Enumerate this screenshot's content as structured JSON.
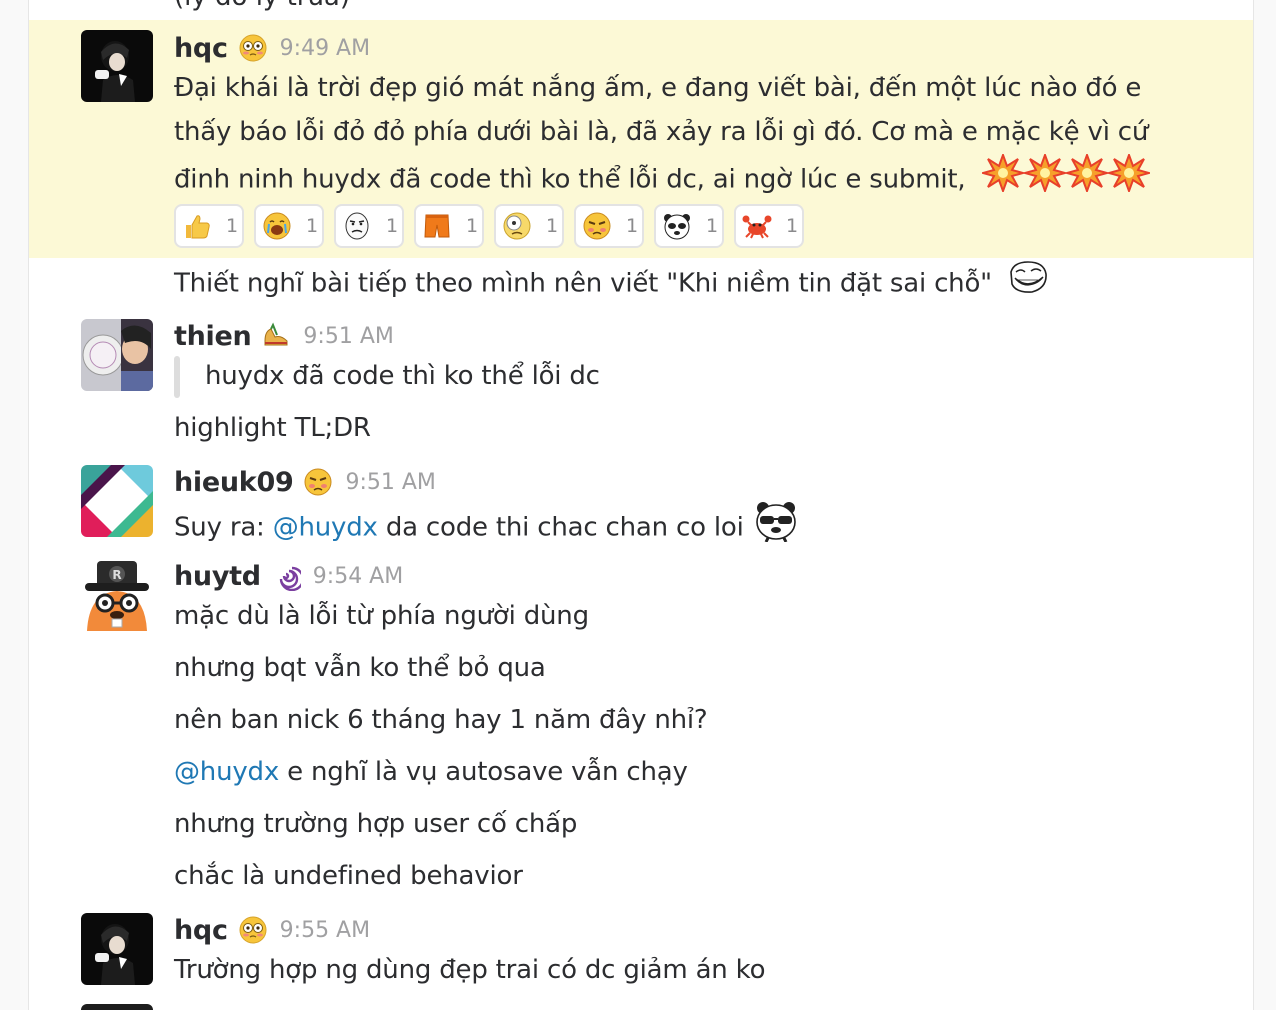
{
  "top_cut_text": "(lý do lý trưa)",
  "messages": [
    {
      "author": "hqc",
      "time": "9:49 AM",
      "lines": [
        "Đại khái là trời đẹp gió mát nắng ấm, e đang viết bài, đến một lúc nào đó e",
        "thấy báo lỗi đỏ đỏ phía dưới bài là, đã xảy ra lỗi gì đó. Cơ mà e mặc kệ vì cứ",
        "đinh ninh huydx đã code thì ko thể lỗi dc, ai ngờ lúc e submit,"
      ],
      "reactions": [
        {
          "icon": "thumbs-up-icon",
          "count": "1"
        },
        {
          "icon": "crying-face-icon",
          "count": "1"
        },
        {
          "icon": "meme-face-icon",
          "count": "1"
        },
        {
          "icon": "shorts-icon",
          "count": "1"
        },
        {
          "icon": "dizzy-face-icon",
          "count": "1"
        },
        {
          "icon": "angry-face-icon",
          "count": "1"
        },
        {
          "icon": "panda-icon",
          "count": "1"
        },
        {
          "icon": "crab-icon",
          "count": "1"
        }
      ],
      "followup": "Thiết nghĩ bài tiếp theo mình nên viết \"Khi niềm tin đặt sai chỗ\""
    },
    {
      "author": "thien",
      "time": "9:51 AM",
      "quote": "huydx đã code thì ko thể lỗi dc",
      "lines": [
        "highlight TL;DR"
      ]
    },
    {
      "author": "hieuk09",
      "time": "9:51 AM",
      "prefix": "Suy ra:",
      "mention": "@huydx",
      "suffix": "da code thi chac chan co loi"
    },
    {
      "author": "huytd",
      "time": "9:54 AM",
      "lines": [
        "mặc dù là lỗi từ phía người dùng",
        "nhưng bqt vẫn ko thể bỏ qua",
        "nên ban nick 6 tháng hay 1 năm đây nhỉ?"
      ],
      "mention_line": {
        "mention": "@huydx",
        "text": "e nghĩ là vụ autosave vẫn chạy"
      },
      "lines_after": [
        "nhưng trường hợp user cố chấp",
        "chắc là undefined behavior"
      ]
    },
    {
      "author": "hqc",
      "time": "9:55 AM",
      "lines": [
        "Trường hợp ng dùng đẹp trai có dc giảm án ko"
      ]
    }
  ],
  "colors": {
    "highlight": "#fcf9d6",
    "mention": "#1f78b4",
    "timestamp": "#a0a0a2"
  }
}
